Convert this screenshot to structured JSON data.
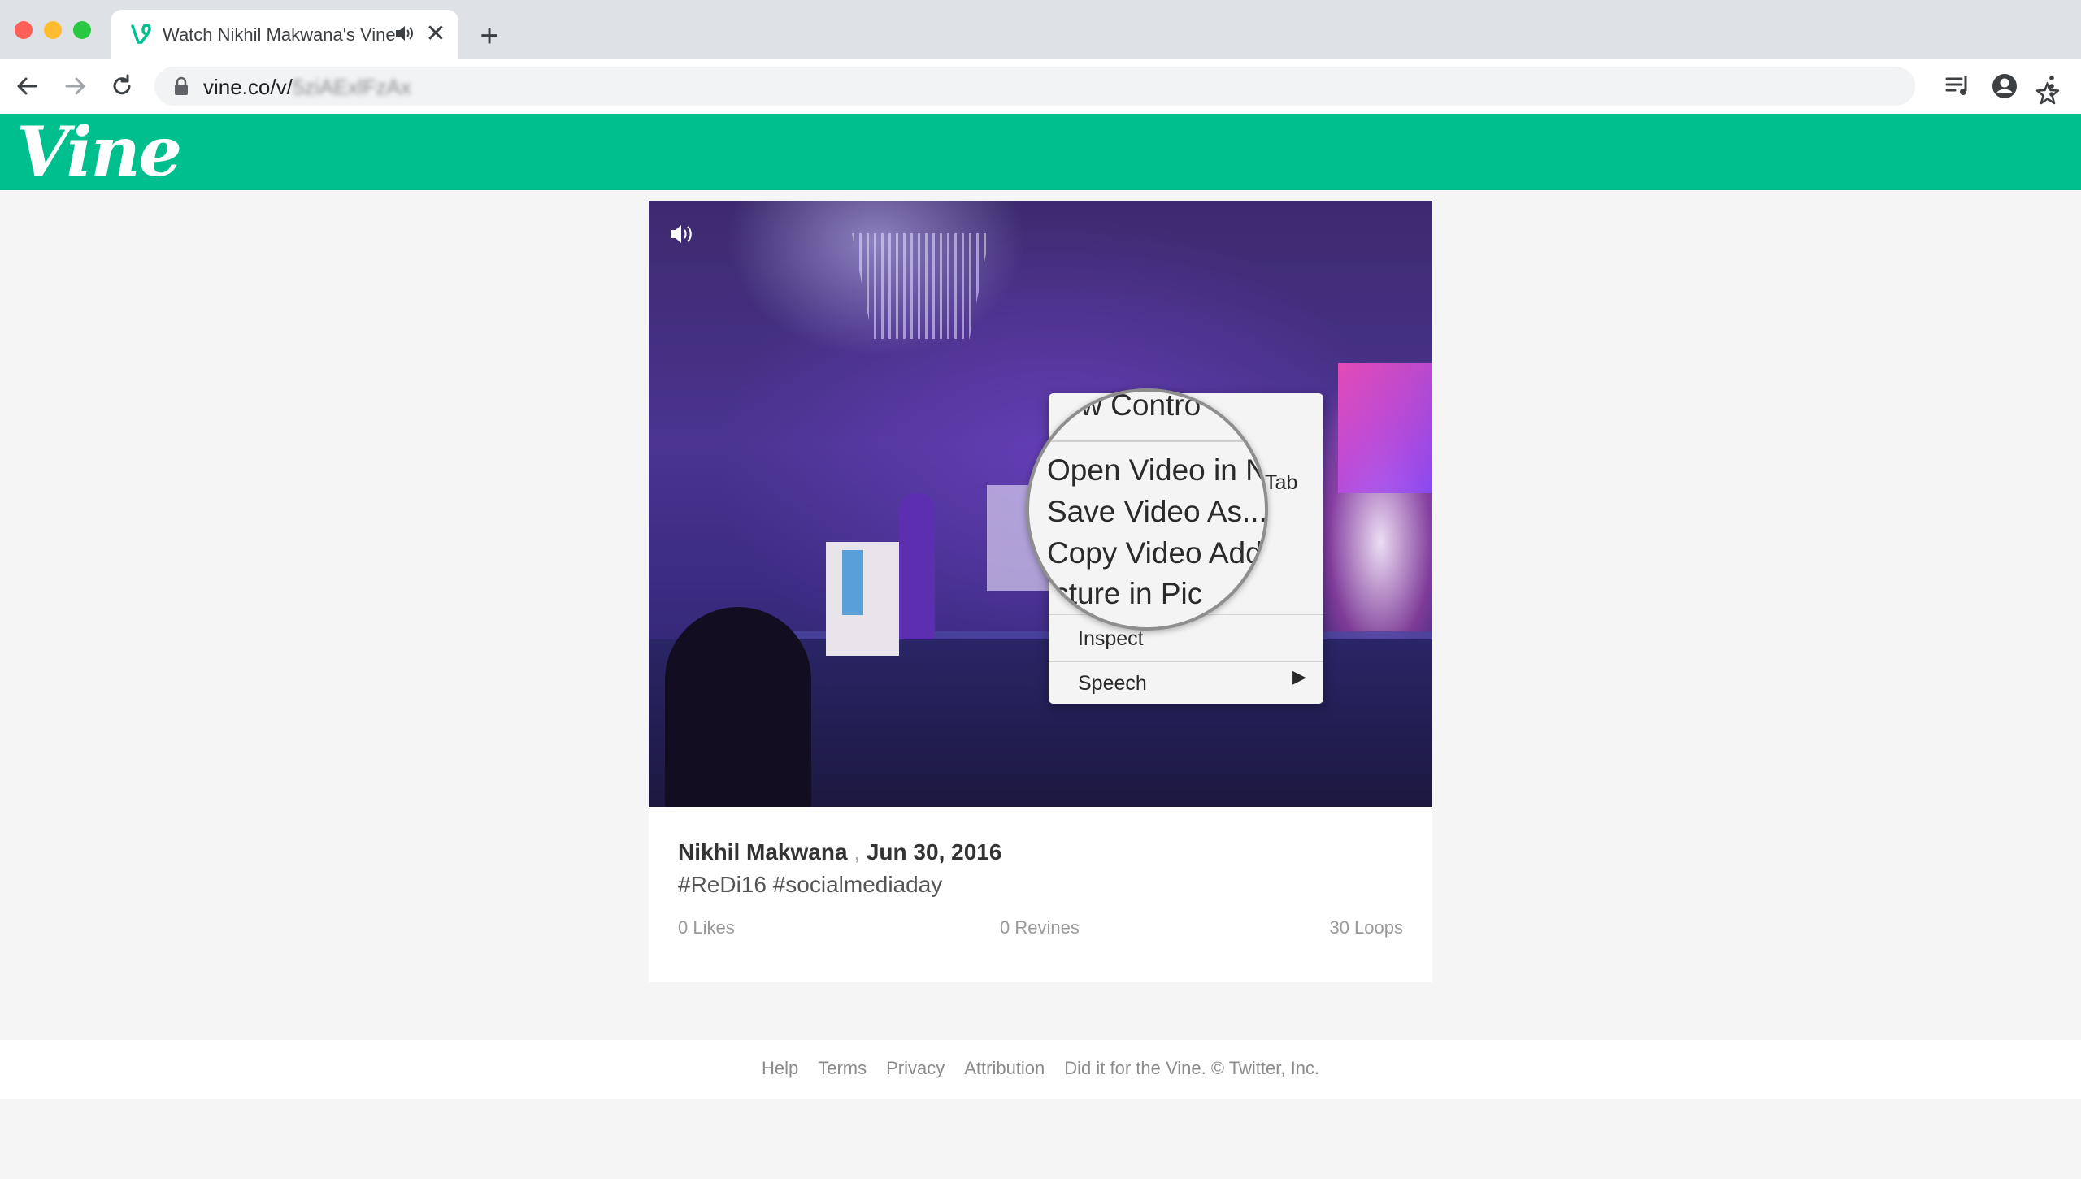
{
  "browser": {
    "tab_title": "Watch Nikhil Makwana's Vine",
    "tab_audio_icon": "speaker-icon",
    "close_label": "✕",
    "new_tab_label": "+",
    "url_prefix": "vine.co/v/",
    "url_hidden": "5ziAExlFzAx"
  },
  "site": {
    "logo": "Vine",
    "brand_color": "#00bf8f"
  },
  "context_menu": {
    "items": [
      "Show Controls",
      "Open Video in New Tab",
      "Save Video As...",
      "Copy Video Address",
      "Picture in Picture",
      "Inspect",
      "Speech"
    ],
    "visible_fragments": {
      "tab": "Tab",
      "s": "s",
      "inspect": "Inspect",
      "speech": "Speech",
      "submenu_arrow": "▶"
    },
    "magnified": [
      "how Contro",
      "Open Video in N",
      "Save Video As...",
      "Copy Video Add",
      "icture in Pic"
    ]
  },
  "post": {
    "author": "Nikhil Makwana",
    "separator": " , ",
    "date": "Jun 30, 2016",
    "caption": "#ReDi16 #socialmediaday",
    "likes": "0 Likes",
    "revines": "0 Revines",
    "loops": "30 Loops"
  },
  "footer": {
    "links": [
      "Help",
      "Terms",
      "Privacy",
      "Attribution"
    ],
    "credit": "Did it for the Vine. © Twitter, Inc."
  }
}
